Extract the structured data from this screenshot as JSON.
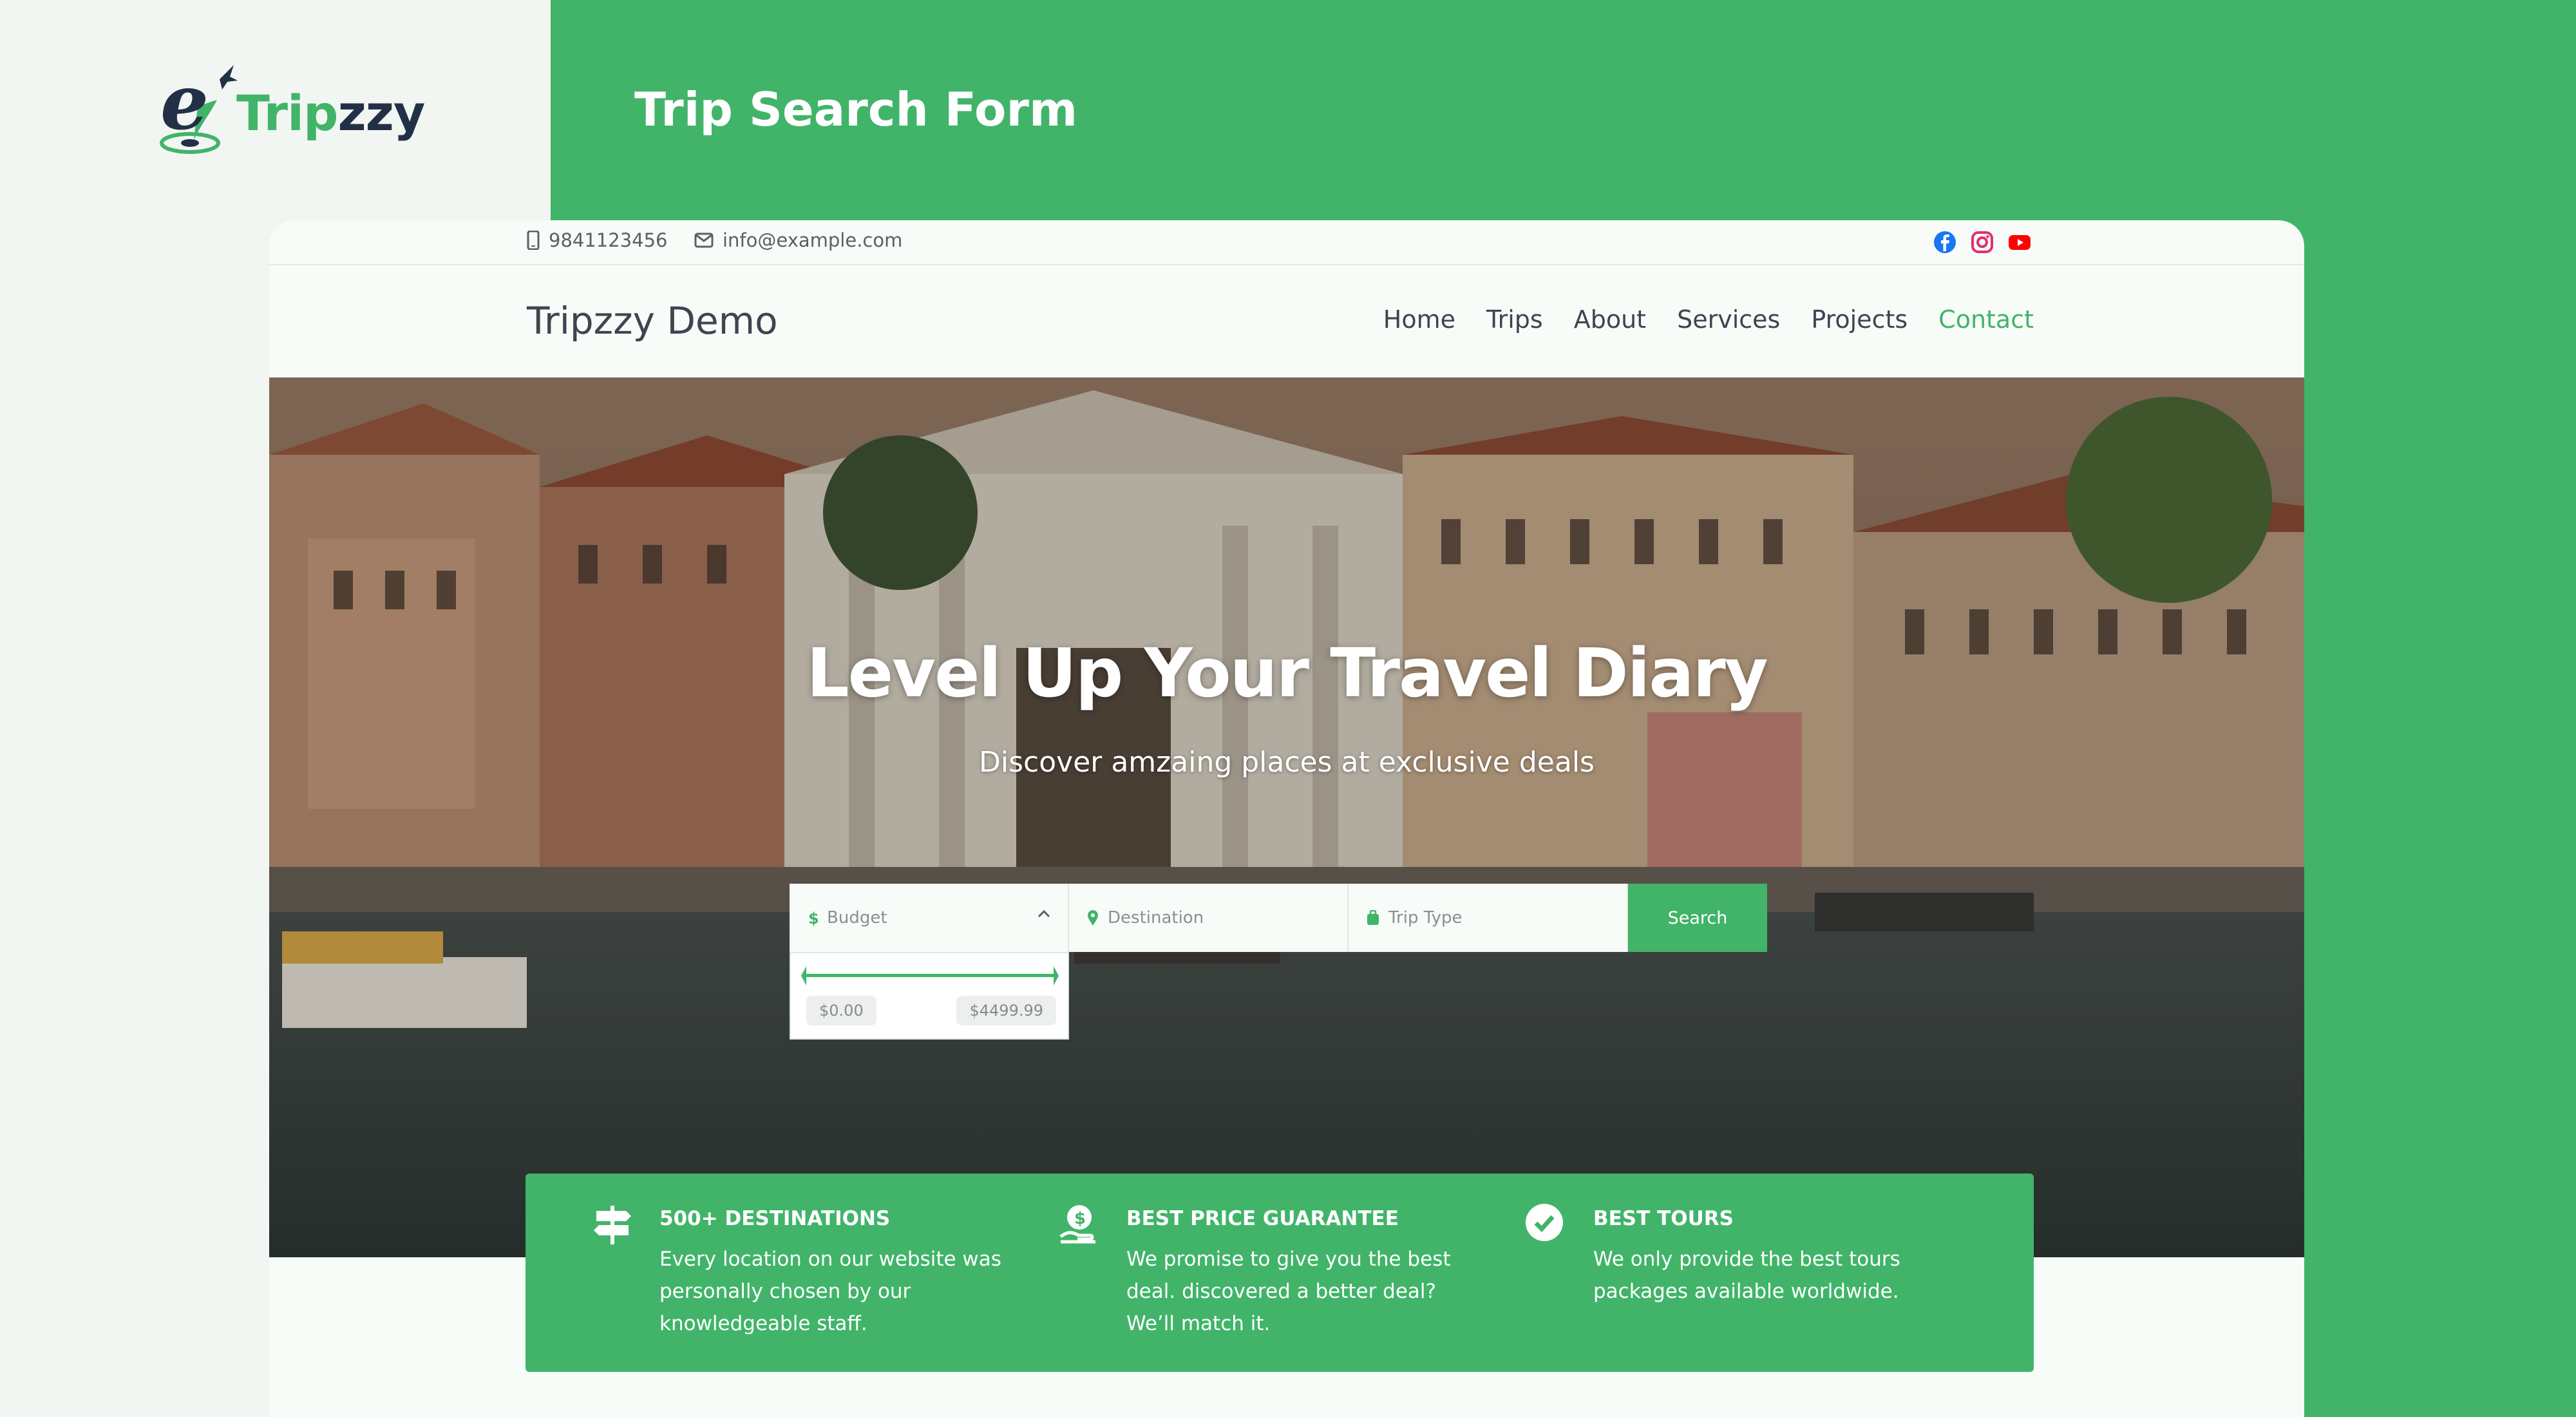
{
  "brand": {
    "logo_text_green": "Trip",
    "logo_text_dark": "zzy",
    "logo_letter": "e"
  },
  "page_heading": "Trip Search Form",
  "topbar": {
    "phone": "9841123456",
    "email": "info@example.com",
    "social": [
      "facebook-icon",
      "instagram-icon",
      "youtube-icon"
    ]
  },
  "navbar": {
    "site_title": "Tripzzy Demo",
    "items": [
      {
        "label": "Home"
      },
      {
        "label": "Trips"
      },
      {
        "label": "About"
      },
      {
        "label": "Services"
      },
      {
        "label": "Projects"
      },
      {
        "label": "Contact",
        "active": true
      }
    ]
  },
  "hero": {
    "title": "Level Up Your Travel Diary",
    "subtitle": "Discover amzaing places at exclusive deals"
  },
  "search": {
    "budget_placeholder": "Budget",
    "destination_placeholder": "Destination",
    "trip_type_placeholder": "Trip Type",
    "button_label": "Search",
    "budget_min": "$0.00",
    "budget_max": "$4499.99"
  },
  "features": [
    {
      "icon": "signpost-icon",
      "title": "500+ DESTINATIONS",
      "text": "Every location on our website was personally chosen by our knowledgeable staff."
    },
    {
      "icon": "money-bag-icon",
      "title": "BEST PRICE GUARANTEE",
      "text": "We promise to give you the best deal. discovered a better deal? We’ll match it."
    },
    {
      "icon": "check-circle-icon",
      "title": "BEST TOURS",
      "text": "We only provide the best tours packages available worldwide."
    }
  ],
  "colors": {
    "accent": "#41b469",
    "dark": "#223047",
    "text": "#3e4450"
  }
}
